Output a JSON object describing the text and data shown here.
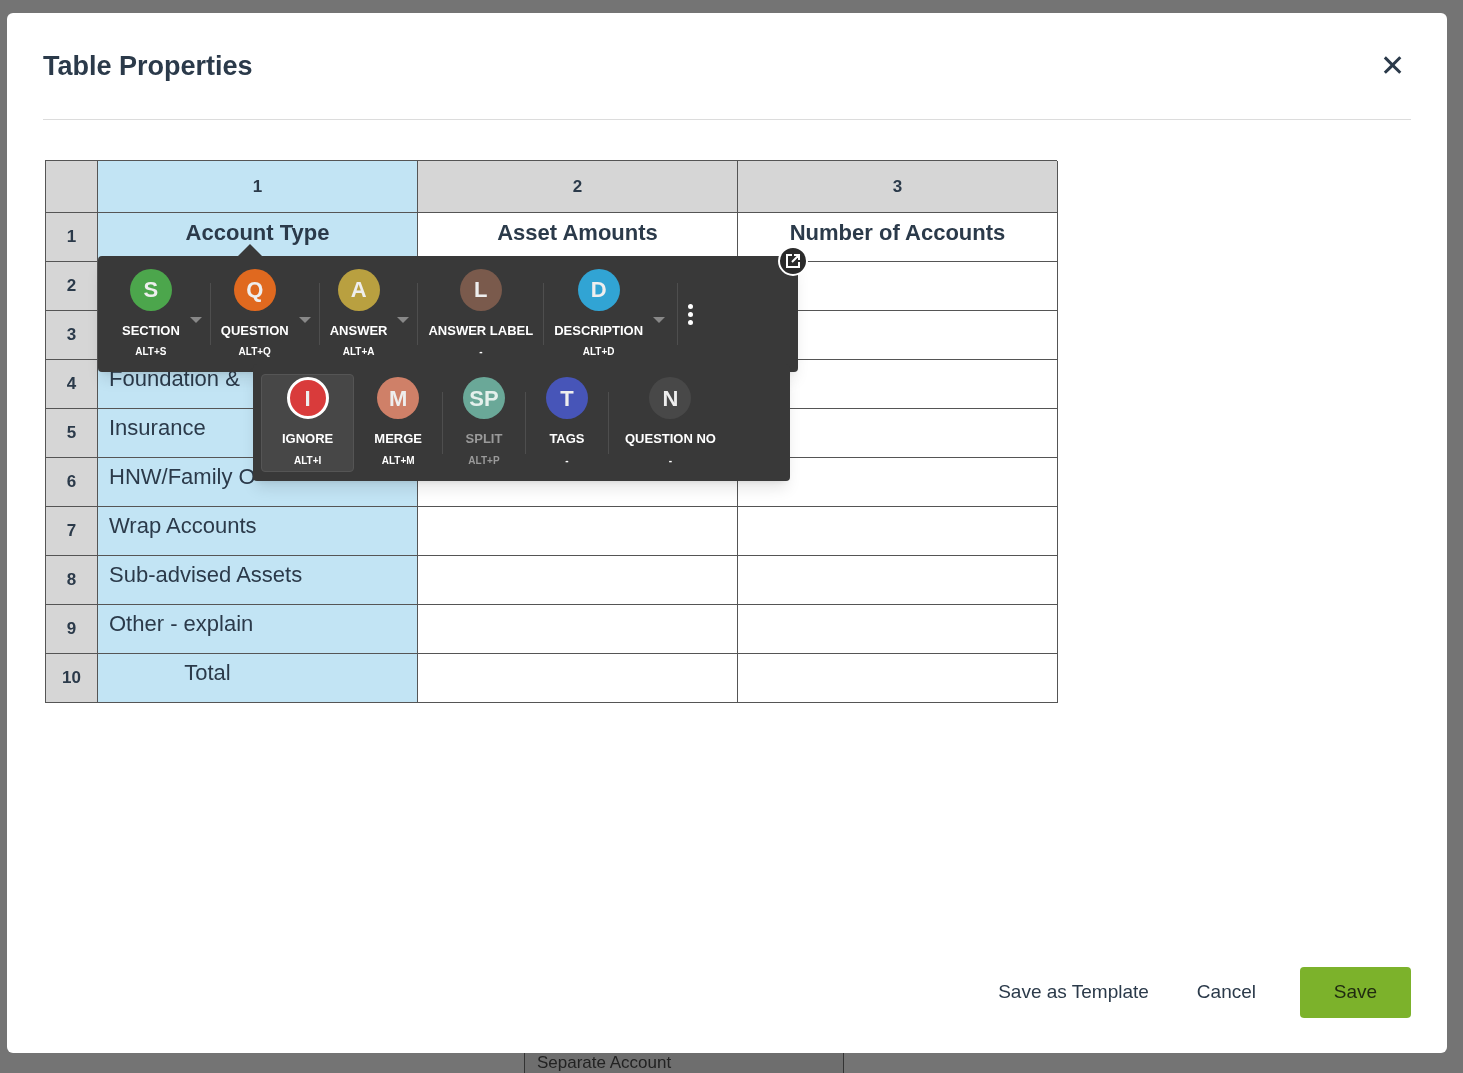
{
  "background": {
    "text": "Separate Account"
  },
  "dialog": {
    "title": "Table Properties",
    "close": "✕"
  },
  "table": {
    "columns": [
      {
        "label": "1",
        "selected": true
      },
      {
        "label": "2",
        "selected": false
      },
      {
        "label": "3",
        "selected": false
      }
    ],
    "rows": [
      {
        "number": "1",
        "kind": "heading",
        "column_1": "Account Type",
        "column_2": "Asset Amounts",
        "column_3": "Number of Accounts"
      },
      {
        "number": "2",
        "kind": "item"
      },
      {
        "number": "3",
        "kind": "item"
      },
      {
        "number": "4",
        "kind": "item",
        "column_1": "Foundation &"
      },
      {
        "number": "5",
        "kind": "item",
        "column_1": "Insurance"
      },
      {
        "number": "6",
        "kind": "item",
        "column_1": "HNW/Family O"
      },
      {
        "number": "7",
        "kind": "item",
        "column_1": "Wrap Accounts"
      },
      {
        "number": "8",
        "kind": "item",
        "column_1": "Sub-advised Assets"
      },
      {
        "number": "9",
        "kind": "item",
        "column_1": "Other - explain"
      },
      {
        "number": "10",
        "kind": "total",
        "column_1": "Total"
      }
    ]
  },
  "toolbar": {
    "items": [
      {
        "letter": "S",
        "label": "SECTION",
        "shortcut": "ALT+S",
        "color": "#4ca64c",
        "dropdown": true
      },
      {
        "letter": "Q",
        "label": "QUESTION",
        "shortcut": "ALT+Q",
        "color": "#e0691f",
        "dropdown": true
      },
      {
        "letter": "A",
        "label": "ANSWER",
        "shortcut": "ALT+A",
        "color": "#b9a040",
        "dropdown": true
      },
      {
        "letter": "L",
        "label": "ANSWER LABEL",
        "shortcut": "-",
        "color": "#7a5a4c",
        "dropdown": false
      },
      {
        "letter": "D",
        "label": "DESCRIPTION",
        "shortcut": "ALT+D",
        "color": "#31a4d4",
        "dropdown": true
      }
    ]
  },
  "toolbar_more": {
    "items": [
      {
        "letter": "I",
        "label": "IGNORE",
        "shortcut": "ALT+I",
        "color": "#d93b3b",
        "selected": true,
        "disabled": false
      },
      {
        "letter": "M",
        "label": "MERGE",
        "shortcut": "ALT+M",
        "color": "#cf8068",
        "selected": false,
        "disabled": false
      },
      {
        "letter": "SP",
        "label": "SPLIT",
        "shortcut": "ALT+P",
        "color": "#6aa898",
        "selected": false,
        "disabled": true
      },
      {
        "letter": "T",
        "label": "TAGS",
        "shortcut": "-",
        "color": "#4755b8",
        "selected": false,
        "disabled": false
      },
      {
        "letter": "N",
        "label": "QUESTION NO",
        "shortcut": "-",
        "color": "#484848",
        "selected": false,
        "disabled": false
      }
    ]
  },
  "buttons": [
    {
      "label": "Save as Template",
      "kind": "text"
    },
    {
      "label": "Cancel",
      "kind": "text"
    },
    {
      "label": "Save",
      "kind": "primary"
    }
  ]
}
